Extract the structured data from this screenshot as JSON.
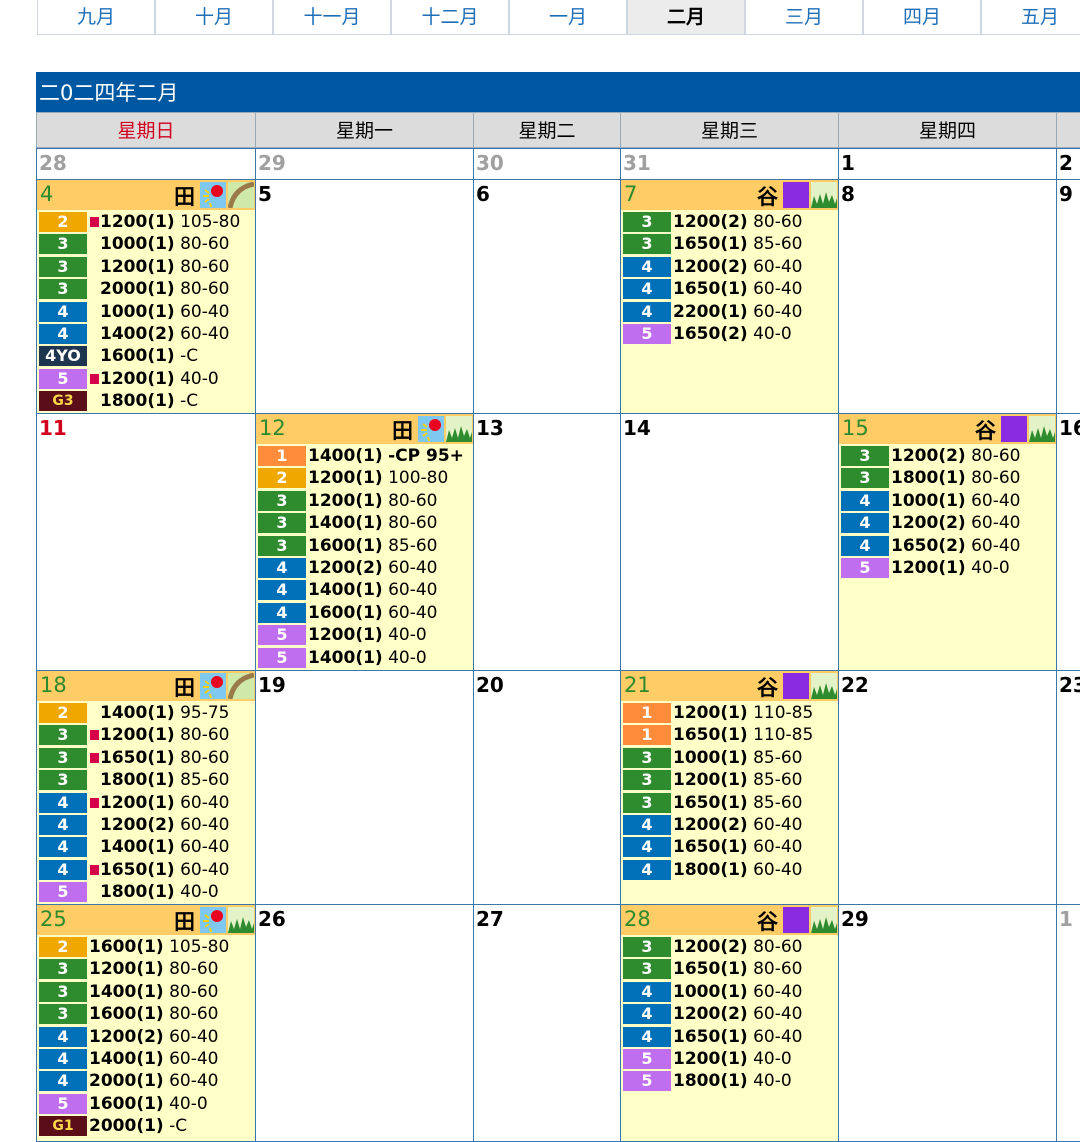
{
  "month_tabs": [
    {
      "label": "九月",
      "active": false
    },
    {
      "label": "十月",
      "active": false
    },
    {
      "label": "十一月",
      "active": false
    },
    {
      "label": "十二月",
      "active": false
    },
    {
      "label": "一月",
      "active": false
    },
    {
      "label": "二月",
      "active": true
    },
    {
      "label": "三月",
      "active": false
    },
    {
      "label": "四月",
      "active": false
    },
    {
      "label": "五月",
      "active": false
    }
  ],
  "calendar_title": "二0二四年二月",
  "weekdays": [
    "星期日",
    "星期一",
    "星期二",
    "星期三",
    "星期四",
    ""
  ],
  "colors": {
    "header": "#0058a3",
    "meet_bg": "#ffffc8",
    "meet_head": "#ffcc66",
    "sunday": "#d2001e"
  },
  "weeks": [
    [
      {
        "day": "28",
        "other": true
      },
      {
        "day": "29",
        "other": true
      },
      {
        "day": "30",
        "other": true
      },
      {
        "day": "31",
        "other": true
      },
      {
        "day": "1"
      },
      {
        "day": "2"
      }
    ],
    [
      {
        "day": "4",
        "meet": {
          "venue": "田",
          "icons": [
            "sun-icon",
            "turf-course-icon"
          ],
          "races": [
            {
              "cls": "2",
              "flag": true,
              "dist": "1200(1)",
              "rating": "105-80"
            },
            {
              "cls": "3",
              "flag": false,
              "dist": "1000(1)",
              "rating": "80-60"
            },
            {
              "cls": "3",
              "flag": false,
              "dist": "1200(1)",
              "rating": "80-60"
            },
            {
              "cls": "3",
              "flag": false,
              "dist": "2000(1)",
              "rating": "80-60"
            },
            {
              "cls": "4",
              "flag": false,
              "dist": "1000(1)",
              "rating": "60-40"
            },
            {
              "cls": "4",
              "flag": false,
              "dist": "1400(2)",
              "rating": "60-40"
            },
            {
              "cls": "4YO",
              "flag": false,
              "dist": "1600(1)",
              "rating": "-C"
            },
            {
              "cls": "5",
              "flag": true,
              "dist": "1200(1)",
              "rating": "40-0"
            },
            {
              "cls": "G3",
              "flag": false,
              "dist": "1800(1)",
              "rating": "-C"
            }
          ]
        }
      },
      {
        "day": "5"
      },
      {
        "day": "6"
      },
      {
        "day": "7",
        "meet": {
          "venue": "谷",
          "icons": [
            "moon-icon",
            "grass-icon"
          ],
          "races": [
            {
              "cls": "3",
              "dist": "1200(2)",
              "rating": "80-60"
            },
            {
              "cls": "3",
              "dist": "1650(1)",
              "rating": "85-60"
            },
            {
              "cls": "4",
              "dist": "1200(2)",
              "rating": "60-40"
            },
            {
              "cls": "4",
              "dist": "1650(1)",
              "rating": "60-40"
            },
            {
              "cls": "4",
              "dist": "2200(1)",
              "rating": "60-40"
            },
            {
              "cls": "5",
              "dist": "1650(2)",
              "rating": "40-0"
            }
          ]
        }
      },
      {
        "day": "8"
      },
      {
        "day": "9"
      }
    ],
    [
      {
        "day": "11",
        "sun": true
      },
      {
        "day": "12",
        "meet": {
          "venue": "田",
          "icons": [
            "sun-icon",
            "grass-icon"
          ],
          "races": [
            {
              "cls": "1",
              "dist": "1400(1)",
              "rating": "-CP 95+",
              "bold_c": true
            },
            {
              "cls": "2",
              "dist": "1200(1)",
              "rating": "100-80"
            },
            {
              "cls": "3",
              "dist": "1200(1)",
              "rating": "80-60"
            },
            {
              "cls": "3",
              "dist": "1400(1)",
              "rating": "80-60"
            },
            {
              "cls": "3",
              "dist": "1600(1)",
              "rating": "85-60"
            },
            {
              "cls": "4",
              "dist": "1200(2)",
              "rating": "60-40"
            },
            {
              "cls": "4",
              "dist": "1400(1)",
              "rating": "60-40"
            },
            {
              "cls": "4",
              "dist": "1600(1)",
              "rating": "60-40"
            },
            {
              "cls": "5",
              "dist": "1200(1)",
              "rating": "40-0"
            },
            {
              "cls": "5",
              "dist": "1400(1)",
              "rating": "40-0"
            }
          ]
        }
      },
      {
        "day": "13"
      },
      {
        "day": "14"
      },
      {
        "day": "15",
        "meet": {
          "venue": "谷",
          "icons": [
            "moon-icon",
            "grass-icon"
          ],
          "races": [
            {
              "cls": "3",
              "dist": "1200(2)",
              "rating": "80-60"
            },
            {
              "cls": "3",
              "dist": "1800(1)",
              "rating": "80-60"
            },
            {
              "cls": "4",
              "dist": "1000(1)",
              "rating": "60-40"
            },
            {
              "cls": "4",
              "dist": "1200(2)",
              "rating": "60-40"
            },
            {
              "cls": "4",
              "dist": "1650(2)",
              "rating": "60-40"
            },
            {
              "cls": "5",
              "dist": "1200(1)",
              "rating": "40-0"
            }
          ]
        }
      },
      {
        "day": "16"
      }
    ],
    [
      {
        "day": "18",
        "meet": {
          "venue": "田",
          "icons": [
            "sun-icon",
            "turf-course-icon"
          ],
          "races": [
            {
              "cls": "2",
              "flag": false,
              "dist": "1400(1)",
              "rating": "95-75"
            },
            {
              "cls": "3",
              "flag": true,
              "dist": "1200(1)",
              "rating": "80-60"
            },
            {
              "cls": "3",
              "flag": true,
              "dist": "1650(1)",
              "rating": "80-60"
            },
            {
              "cls": "3",
              "flag": false,
              "dist": "1800(1)",
              "rating": "85-60"
            },
            {
              "cls": "4",
              "flag": true,
              "dist": "1200(1)",
              "rating": "60-40"
            },
            {
              "cls": "4",
              "flag": false,
              "dist": "1200(2)",
              "rating": "60-40"
            },
            {
              "cls": "4",
              "flag": false,
              "dist": "1400(1)",
              "rating": "60-40"
            },
            {
              "cls": "4",
              "flag": true,
              "dist": "1650(1)",
              "rating": "60-40"
            },
            {
              "cls": "5",
              "flag": false,
              "dist": "1800(1)",
              "rating": "40-0"
            }
          ]
        }
      },
      {
        "day": "19"
      },
      {
        "day": "20"
      },
      {
        "day": "21",
        "meet": {
          "venue": "谷",
          "icons": [
            "moon-icon",
            "grass-icon"
          ],
          "races": [
            {
              "cls": "1",
              "dist": "1200(1)",
              "rating": "110-85"
            },
            {
              "cls": "1",
              "dist": "1650(1)",
              "rating": "110-85"
            },
            {
              "cls": "3",
              "dist": "1000(1)",
              "rating": "85-60"
            },
            {
              "cls": "3",
              "dist": "1200(1)",
              "rating": "85-60"
            },
            {
              "cls": "3",
              "dist": "1650(1)",
              "rating": "85-60"
            },
            {
              "cls": "4",
              "dist": "1200(2)",
              "rating": "60-40"
            },
            {
              "cls": "4",
              "dist": "1650(1)",
              "rating": "60-40"
            },
            {
              "cls": "4",
              "dist": "1800(1)",
              "rating": "60-40"
            }
          ]
        }
      },
      {
        "day": "22"
      },
      {
        "day": "23"
      }
    ],
    [
      {
        "day": "25",
        "meet": {
          "venue": "田",
          "icons": [
            "sun-icon",
            "grass-icon"
          ],
          "races": [
            {
              "cls": "2",
              "dist": "1600(1)",
              "rating": "105-80"
            },
            {
              "cls": "3",
              "dist": "1200(1)",
              "rating": "80-60"
            },
            {
              "cls": "3",
              "dist": "1400(1)",
              "rating": "80-60"
            },
            {
              "cls": "3",
              "dist": "1600(1)",
              "rating": "80-60"
            },
            {
              "cls": "4",
              "dist": "1200(2)",
              "rating": "60-40"
            },
            {
              "cls": "4",
              "dist": "1400(1)",
              "rating": "60-40"
            },
            {
              "cls": "4",
              "dist": "2000(1)",
              "rating": "60-40"
            },
            {
              "cls": "5",
              "dist": "1600(1)",
              "rating": "40-0"
            },
            {
              "cls": "G1",
              "dist": "2000(1)",
              "rating": "-C"
            }
          ]
        }
      },
      {
        "day": "26"
      },
      {
        "day": "27"
      },
      {
        "day": "28",
        "meet": {
          "venue": "谷",
          "icons": [
            "moon-icon",
            "grass-icon"
          ],
          "races": [
            {
              "cls": "3",
              "dist": "1200(2)",
              "rating": "80-60"
            },
            {
              "cls": "3",
              "dist": "1650(1)",
              "rating": "80-60"
            },
            {
              "cls": "4",
              "dist": "1000(1)",
              "rating": "60-40"
            },
            {
              "cls": "4",
              "dist": "1200(2)",
              "rating": "60-40"
            },
            {
              "cls": "4",
              "dist": "1650(1)",
              "rating": "60-40"
            },
            {
              "cls": "5",
              "dist": "1200(1)",
              "rating": "40-0"
            },
            {
              "cls": "5",
              "dist": "1800(1)",
              "rating": "40-0"
            }
          ]
        }
      },
      {
        "day": "29"
      },
      {
        "day": "1",
        "other": true
      }
    ]
  ]
}
